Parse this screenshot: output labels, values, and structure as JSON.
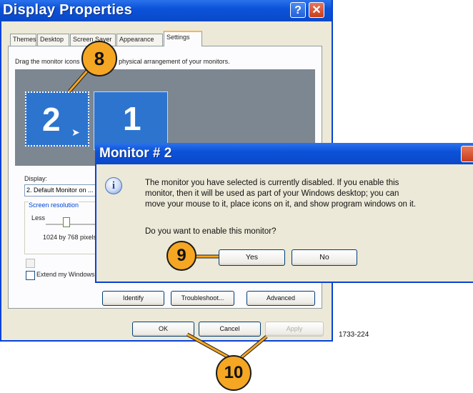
{
  "window": {
    "title": "Display Properties",
    "help_glyph": "?",
    "close_glyph": "✕"
  },
  "tabs": [
    "Themes",
    "Desktop",
    "Screen Saver",
    "Appearance",
    "Settings"
  ],
  "active_tab": "Settings",
  "settings": {
    "instruction": "Drag the monitor icons to match the physical arrangement of your monitors.",
    "monitors": [
      {
        "number": "2",
        "selected": true
      },
      {
        "number": "1",
        "selected": false
      }
    ],
    "display_label": "Display:",
    "display_value": "2. Default Monitor on ...",
    "resolution_label": "Screen resolution",
    "resolution_less": "Less",
    "resolution_value": "1024 by 768 pixels",
    "extend_label": "Extend my Windows desktop onto this monitor.",
    "extend_checked": false
  },
  "buttons": {
    "identify": "Identify",
    "troubleshoot": "Troubleshoot...",
    "advanced": "Advanced",
    "ok": "OK",
    "cancel": "Cancel",
    "apply": "Apply"
  },
  "monitor_dialog": {
    "title": "Monitor # 2",
    "message_lines": [
      "The monitor you have selected is currently disabled. If you enable this",
      "monitor, then it will be used as part of your Windows desktop; you can",
      "move your mouse to it, place icons on it, and show program windows on it."
    ],
    "question": "Do you want to enable this monitor?",
    "yes": "Yes",
    "no": "No",
    "icon": "info-icon"
  },
  "callouts": [
    "8",
    "9",
    "10"
  ],
  "figure_code": "1733-224",
  "colors": {
    "title_bar": "#0b52d9",
    "callout": "#f5a623",
    "monitor_tile": "#2d74cf"
  }
}
